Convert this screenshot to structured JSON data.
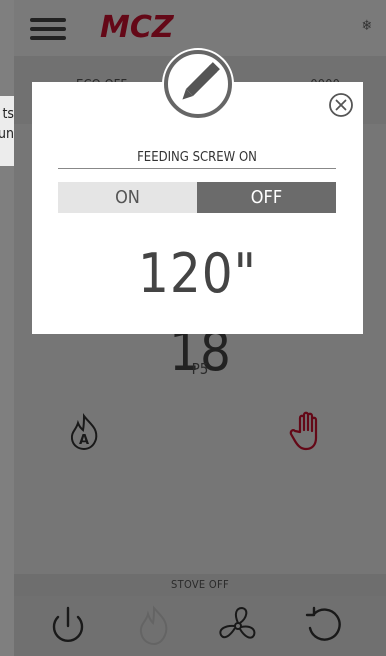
{
  "app": {
    "logo_text": "MCZ",
    "brand_color": "#c8102e",
    "header_right_icon": "snowflake-icon"
  },
  "mode_bar": {
    "left_label": "ECO OFF",
    "right_label": "0000"
  },
  "left_edge_text": [
    "ts",
    "un"
  ],
  "main": {
    "temperature": "18",
    "power_level": "P5",
    "auto_icon": "flame-a-icon",
    "manual_icon": "hand-icon"
  },
  "status_bar": {
    "text": "STOVE OFF"
  },
  "bottom_bar": {
    "icons": [
      "power-icon",
      "flame-icon",
      "fan-icon",
      "refresh-icon"
    ]
  },
  "dialog": {
    "title": "FEEDING SCREW ON",
    "on_label": "ON",
    "off_label": "OFF",
    "selected": "OFF",
    "value": "120\"",
    "edit_icon": "pencil-icon",
    "close_icon": "close-icon"
  }
}
